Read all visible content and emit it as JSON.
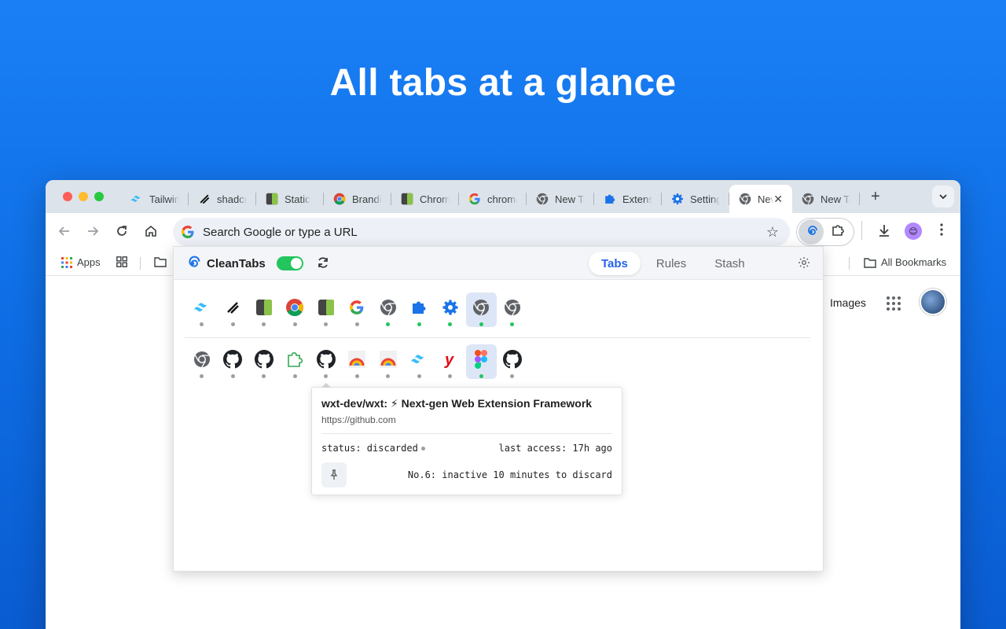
{
  "headline": "All tabs at a glance",
  "browser": {
    "tabs": [
      {
        "label": "Tailwind",
        "icon": "tailwind-icon"
      },
      {
        "label": "shadcn",
        "icon": "shadcn-icon"
      },
      {
        "label": "Static",
        "icon": "green-block-icon"
      },
      {
        "label": "Branding",
        "icon": "chrome-color-icon"
      },
      {
        "label": "Chrome",
        "icon": "green-block-icon"
      },
      {
        "label": "chrome",
        "icon": "google-icon"
      },
      {
        "label": "New Tab",
        "icon": "chrome-gray-icon"
      },
      {
        "label": "Extensions",
        "icon": "puzzle-icon"
      },
      {
        "label": "Settings",
        "icon": "gear-icon"
      },
      {
        "label": "New Tab",
        "icon": "chrome-gray-icon",
        "active": true
      },
      {
        "label": "New Tab",
        "icon": "chrome-gray-icon"
      }
    ],
    "new_tab_symbol": "+",
    "close_symbol": "✕",
    "omnibox_placeholder": "Search Google or type a URL",
    "bookmarks": {
      "apps": "Apps",
      "all": "All Bookmarks"
    },
    "page": {
      "images_link": "Images"
    }
  },
  "popup": {
    "brand": "CleanTabs",
    "toggle_on": true,
    "tabs": [
      {
        "label": "Tabs",
        "active": true
      },
      {
        "label": "Rules",
        "active": false
      },
      {
        "label": "Stash",
        "active": false
      }
    ],
    "window1": [
      {
        "icon": "tailwind-icon",
        "active": false
      },
      {
        "icon": "shadcn-icon",
        "active": false
      },
      {
        "icon": "green-block-icon",
        "active": false
      },
      {
        "icon": "chrome-color-icon",
        "active": false
      },
      {
        "icon": "green-block-icon",
        "active": false
      },
      {
        "icon": "google-icon",
        "active": false
      },
      {
        "icon": "chrome-gray-icon",
        "active": true
      },
      {
        "icon": "puzzle-icon",
        "active": true
      },
      {
        "icon": "gear-icon",
        "active": true
      },
      {
        "icon": "chrome-gray-icon",
        "active": true,
        "selected": true
      },
      {
        "icon": "chrome-gray-icon",
        "active": true
      }
    ],
    "window2": [
      {
        "icon": "chrome-gray-icon",
        "active": false
      },
      {
        "icon": "github-icon",
        "active": false
      },
      {
        "icon": "github-icon",
        "active": false
      },
      {
        "icon": "puzzle-outline-icon",
        "active": false
      },
      {
        "icon": "github-icon",
        "active": false
      },
      {
        "icon": "rainbow-icon",
        "active": false
      },
      {
        "icon": "rainbow-icon",
        "active": false
      },
      {
        "icon": "tailwind-icon",
        "active": false
      },
      {
        "icon": "yandex-icon",
        "active": false
      },
      {
        "icon": "figma-icon",
        "active": true,
        "selected": true
      },
      {
        "icon": "github-icon",
        "active": false
      }
    ],
    "tooltip": {
      "title": "wxt-dev/wxt: ⚡ Next-gen Web Extension Framework",
      "url": "https://github.com",
      "status": "status: discarded",
      "last_access": "last access: 17h ago",
      "discard_info": "No.6: inactive 10 minutes to discard"
    }
  },
  "colors": {
    "accent_blue": "#2563eb",
    "toggle_green": "#22c55e",
    "background_blue": "#1a7ff5"
  }
}
